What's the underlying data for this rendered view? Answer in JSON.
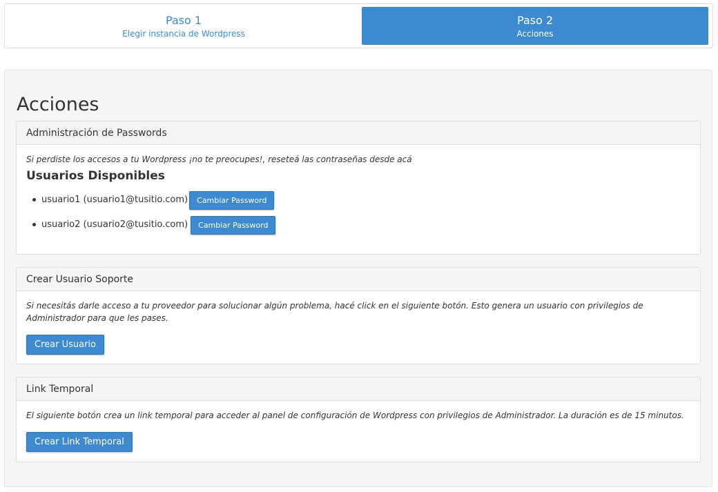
{
  "steps": [
    {
      "title": "Paso 1",
      "subtitle": "Elegir instancia de Wordpress"
    },
    {
      "title": "Paso 2",
      "subtitle": "Acciones"
    }
  ],
  "page": {
    "title": "Acciones"
  },
  "passwords_panel": {
    "heading": "Administración de Passwords",
    "description": "Si perdiste los accesos a tu Wordpress ¡no te preocupes!, reseteá las contraseñas desde acá",
    "users_title": "Usuarios Disponibles",
    "users": [
      {
        "label": "usuario1 (usuario1@tusitio.com)",
        "button": "Cambiar Password"
      },
      {
        "label": "usuario2 (usuario2@tusitio.com)",
        "button": "Cambiar Password"
      }
    ]
  },
  "support_panel": {
    "heading": "Crear Usuario Soporte",
    "description": "Si necesitás darle acceso a tu proveedor para solucionar algún problema, hacé click en el siguiente botón. Esto genera un usuario con privilegios de Administrador para que les pases.",
    "button": "Crear Usuario"
  },
  "link_panel": {
    "heading": "Link Temporal",
    "description": "El siguiente botón crea un link temporal para acceder al panel de configuración de Wordpress con privilegios de Administrador. La duración es de 15 minutos.",
    "button": "Crear Link Temporal"
  },
  "colors": {
    "accent": "#3d8ad0",
    "well_bg": "#f5f5f5",
    "panel_border": "#dddddd"
  }
}
